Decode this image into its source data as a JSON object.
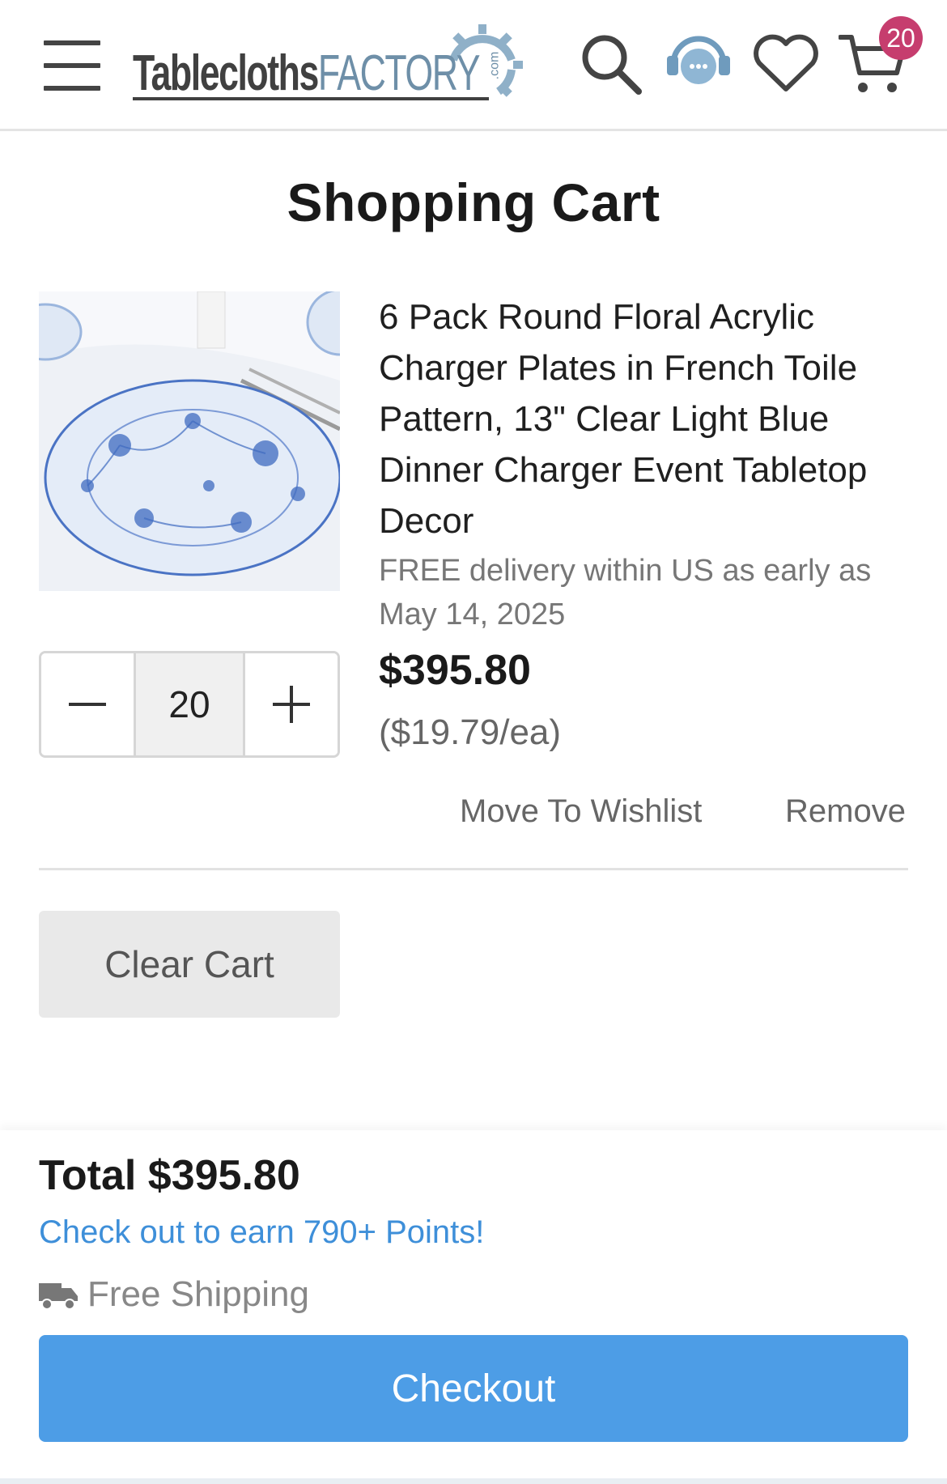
{
  "header": {
    "logo_part1": "Tablecloths",
    "logo_part2": "FACTORY",
    "logo_dotcom": ".com",
    "cart_count": "20",
    "icons": [
      "menu-icon",
      "search-icon",
      "chat-support-icon",
      "heart-icon",
      "cart-icon"
    ]
  },
  "page": {
    "title": "Shopping Cart"
  },
  "item": {
    "name": "6 Pack Round Floral Acrylic Charger Plates in French Toile Pattern, 13\" Clear Light Blue Dinner Charger Event Tabletop Decor",
    "delivery": "FREE delivery within US as early as May 14, 2025",
    "price": "$395.80",
    "unit_price": "($19.79/ea)",
    "quantity": "20",
    "move_to_wishlist": "Move To Wishlist",
    "remove": "Remove"
  },
  "actions": {
    "clear_cart": "Clear Cart"
  },
  "summary": {
    "total": "Total $395.80",
    "points": "Check out to earn 790+ Points!",
    "shipping": "Free Shipping",
    "checkout": "Checkout"
  },
  "colors": {
    "accent": "#4d9de6",
    "points_link": "#3e8fd9",
    "badge": "#c63d6e",
    "logo_blue": "#6e8fa8"
  }
}
